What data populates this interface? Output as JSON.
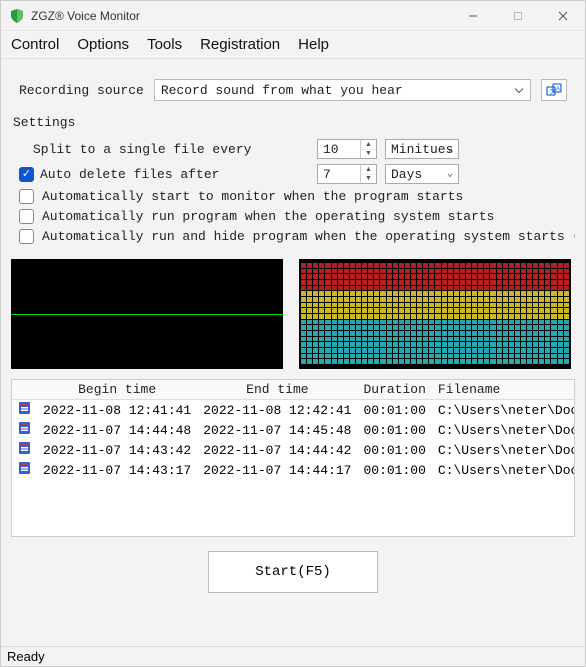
{
  "window": {
    "title": "ZGZ® Voice Monitor"
  },
  "menu": {
    "control": "Control",
    "options": "Options",
    "tools": "Tools",
    "registration": "Registration",
    "help": "Help"
  },
  "source": {
    "label": "Recording source",
    "value": "Record sound from what you hear"
  },
  "settings": {
    "heading": "Settings",
    "split_label": "Split to a single file every",
    "split_value": "10",
    "split_unit": "Minitues",
    "autodel_label": "Auto delete files after",
    "autodel_checked": true,
    "autodel_value": "7",
    "autodel_unit": "Days",
    "opt_autostart_monitor": "Automatically start to monitor when the program starts",
    "opt_autostart_monitor_checked": false,
    "opt_autorun": "Automatically run program when the operating system starts",
    "opt_autorun_checked": false,
    "opt_autorun_hide": "Automatically run and hide program when the operating system starts (Hide and show hotkey...)",
    "opt_autorun_hide_checked": false
  },
  "table": {
    "headers": {
      "begin": "Begin time",
      "end": "End time",
      "duration": "Duration",
      "filename": "Filename"
    },
    "rows": [
      {
        "begin": "2022-11-08 12:41:41",
        "end": "2022-11-08 12:42:41",
        "duration": "00:01:00",
        "filename": "C:\\Users\\neter\\Documents\\JFY ..."
      },
      {
        "begin": "2022-11-07 14:44:48",
        "end": "2022-11-07 14:45:48",
        "duration": "00:01:00",
        "filename": "C:\\Users\\neter\\Documents\\JFY ..."
      },
      {
        "begin": "2022-11-07 14:43:42",
        "end": "2022-11-07 14:44:42",
        "duration": "00:01:00",
        "filename": "C:\\Users\\neter\\Documents\\JFY ..."
      },
      {
        "begin": "2022-11-07 14:43:17",
        "end": "2022-11-07 14:44:17",
        "duration": "00:01:00",
        "filename": "C:\\Users\\neter\\Documents\\JFY ..."
      }
    ]
  },
  "start_label": "Start(F5)",
  "status": "Ready"
}
